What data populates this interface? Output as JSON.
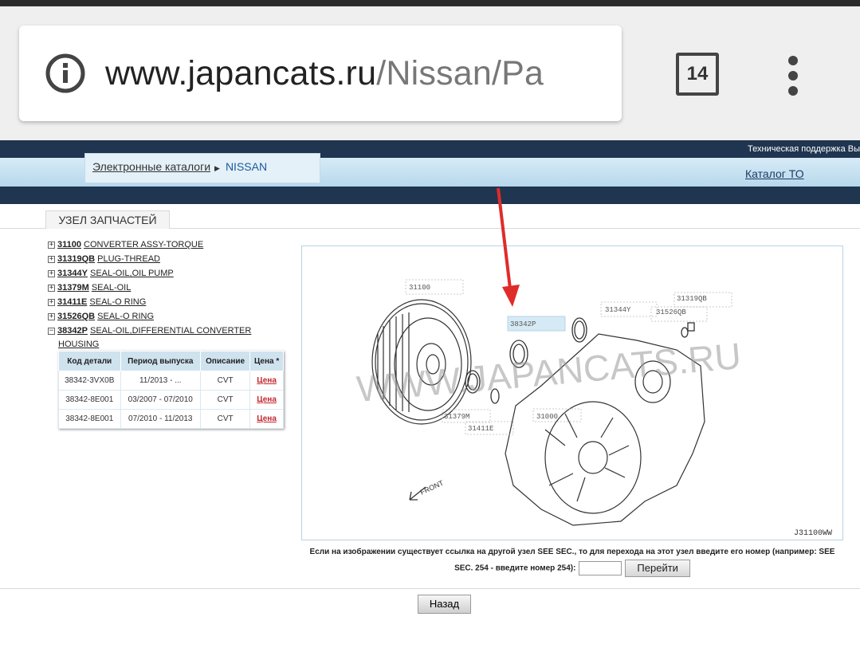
{
  "browser": {
    "url_host": "www.japancats.ru",
    "url_path": "/Nissan/Pa",
    "tab_count": "14"
  },
  "site": {
    "support_text": "Техническая поддержка   Вы",
    "breadcrumb": {
      "catalogs": "Электронные каталоги",
      "brand": "NISSAN"
    },
    "catalog_to": "Каталог ТО"
  },
  "section": {
    "title": "УЗЕЛ ЗАПЧАСТЕЙ"
  },
  "parts_tree": [
    {
      "code": "31100",
      "desc": "CONVERTER ASSY-TORQUE",
      "expanded": false
    },
    {
      "code": "31319QB",
      "desc": "PLUG-THREAD",
      "expanded": false
    },
    {
      "code": "31344Y",
      "desc": "SEAL-OIL,OIL PUMP",
      "expanded": false
    },
    {
      "code": "31379M",
      "desc": "SEAL-OIL",
      "expanded": false
    },
    {
      "code": "31411E",
      "desc": "SEAL-O RING",
      "expanded": false
    },
    {
      "code": "31526QB",
      "desc": "SEAL-O RING",
      "expanded": false
    },
    {
      "code": "38342P",
      "desc": "SEAL-OIL,DIFFERENTIAL CONVERTER",
      "desc_cont": "HOUSING",
      "expanded": true
    }
  ],
  "parts_table": {
    "headers": [
      "Код детали",
      "Период выпуска",
      "Описание",
      "Цена *"
    ],
    "rows": [
      {
        "code": "38342-3VX0B",
        "period": "11/2013 - ...",
        "desc": "CVT",
        "price": "Цена"
      },
      {
        "code": "38342-8E001",
        "period": "03/2007 - 07/2010",
        "desc": "CVT",
        "price": "Цена"
      },
      {
        "code": "38342-8E001",
        "period": "07/2010 - 11/2013",
        "desc": "CVT",
        "price": "Цена"
      }
    ]
  },
  "diagram": {
    "labels": [
      "31100",
      "38342P",
      "31344Y",
      "31319QB",
      "31526QB",
      "31379M",
      "31411E",
      "31000",
      "FRONT"
    ],
    "watermark": "WWW.JAPANCATS.RU",
    "code": "J31100WW"
  },
  "see_sec": {
    "text": "Если на изображении существует ссылка на другой узел SEE SEC., то для перехода на этот узел введите его номер (например: SEE SEC. 254 - введите номер 254):",
    "button": "Перейти"
  },
  "back_button": "Назад",
  "colors": {
    "header_dark": "#1f3550",
    "price_link": "#c2262f",
    "annotation_arrow": "#e02b2b"
  }
}
